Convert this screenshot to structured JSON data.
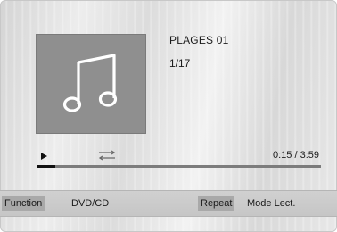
{
  "track": {
    "title": "PLAGES 01",
    "index": "1/17"
  },
  "album_art": {
    "icon": "music-note-icon"
  },
  "playback": {
    "state_icon": "play-icon",
    "repeat_icon": "repeat-icon",
    "elapsed": "0:15",
    "separator": " / ",
    "total": "3:59",
    "progress": 0.063
  },
  "bottom_bar": {
    "function_key": "Function",
    "function_value": "DVD/CD",
    "repeat_key": "Repeat",
    "repeat_value": "Mode Lect."
  },
  "colors": {
    "album_art_bg": "#8f8f8f",
    "bar_bg": "#c6c6c6",
    "badge_bg": "#a9a9a9"
  }
}
